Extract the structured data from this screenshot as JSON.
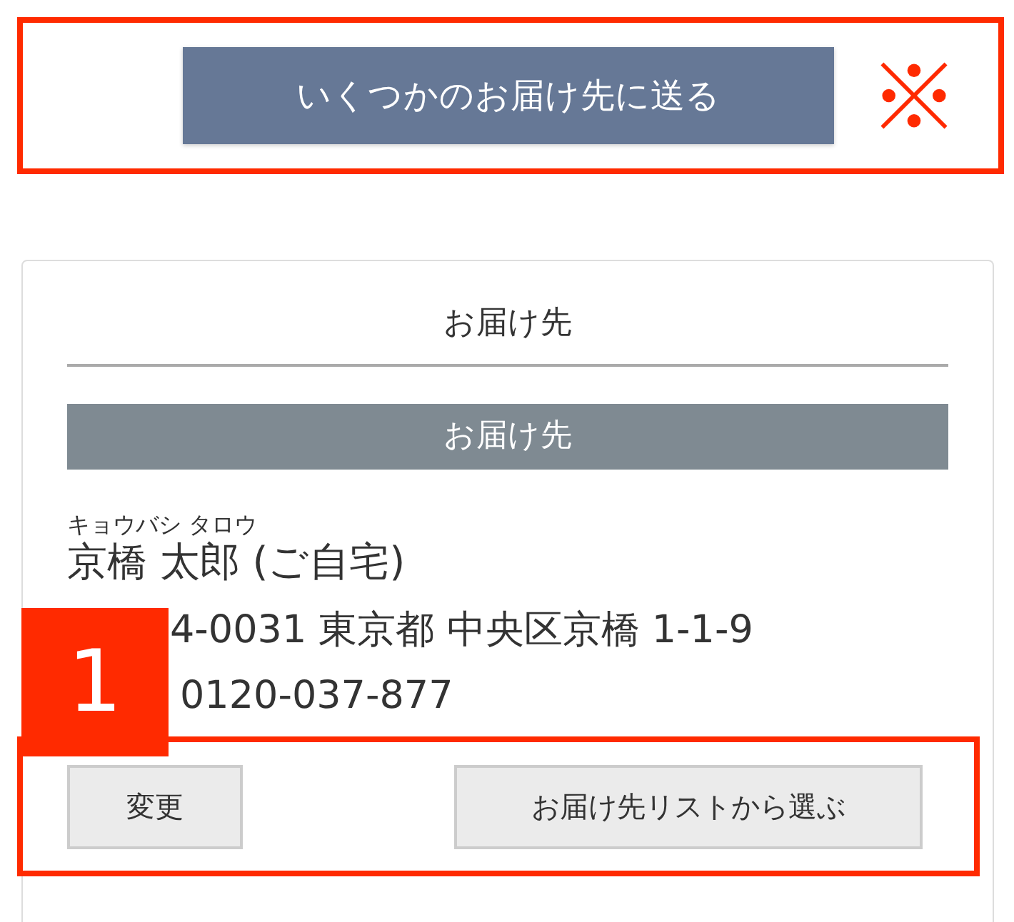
{
  "top_button": "いくつかのお届け先に送る",
  "card": {
    "title": "お届け先",
    "section": "お届け先",
    "furigana": "キョウバシ タロウ",
    "name": "京橋 太郎 (ご自宅)",
    "address": "4-0031 東京都 中央区京橋 1-1-9",
    "phone": "0120-037-877"
  },
  "badge": "1",
  "buttons": [
    "変更",
    "お届け先リストから選ぶ"
  ]
}
